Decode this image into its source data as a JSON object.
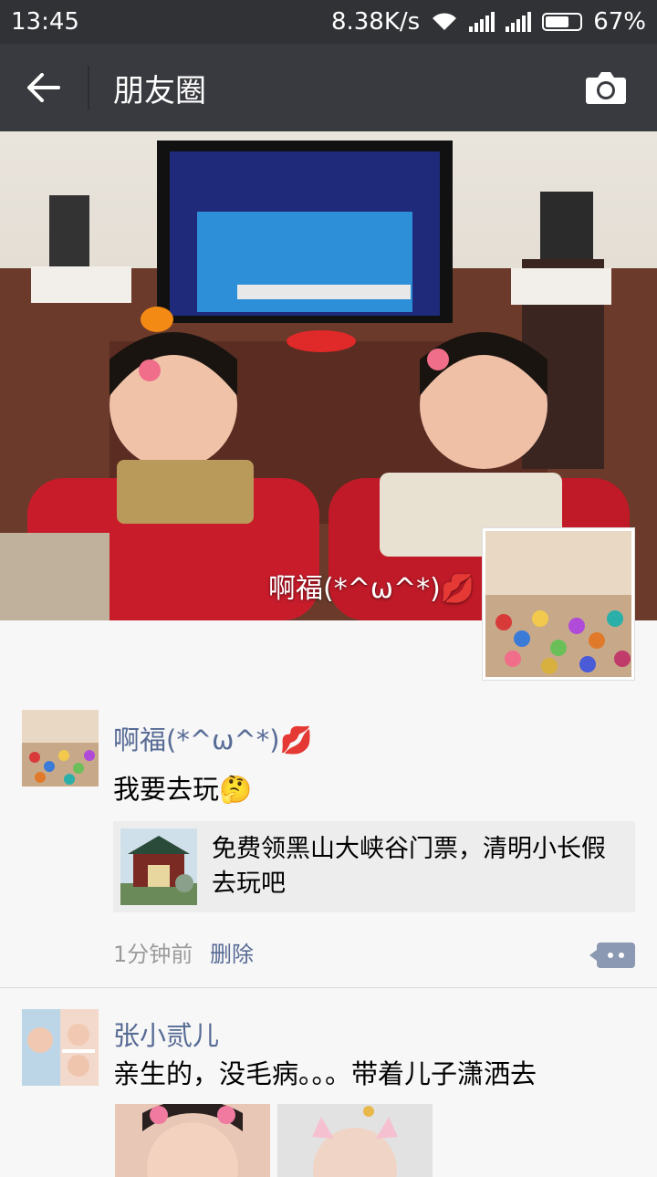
{
  "status": {
    "time": "13:45",
    "speed": "8.38K/s",
    "battery": "67%",
    "icons": [
      "wifi-icon",
      "signal-icon",
      "signal-icon",
      "battery-icon"
    ]
  },
  "nav": {
    "title": "朋友圈",
    "back_icon": "back-arrow-icon",
    "camera_icon": "camera-icon"
  },
  "cover": {
    "user_name": "啊福(*^ω^*)💋"
  },
  "posts": [
    {
      "name": "啊福(*^ω^*)💋",
      "text": "我要去玩🤔",
      "link": {
        "title": "免费领黑山大峡谷门票，清明小长假去玩吧"
      },
      "time": "1分钟前",
      "delete": "删除"
    },
    {
      "name": "张小贰儿",
      "text": "亲生的，没毛病。。。带着儿子潇洒去"
    }
  ],
  "colors": {
    "statusbar": "#303235",
    "navbar": "#393a3f",
    "link": "#576b95",
    "meta": "#9b9b9b",
    "card": "#ededed"
  }
}
